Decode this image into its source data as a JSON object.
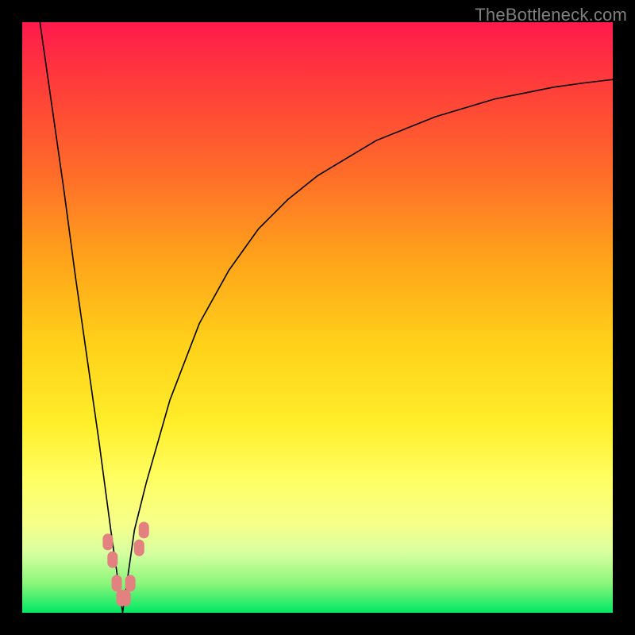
{
  "watermark": "TheBottleneck.com",
  "colors": {
    "frame": "#000000",
    "marker": "#e38080",
    "curve": "#000000",
    "gradient_top": "#ff1a4d",
    "gradient_bottom": "#00e865"
  },
  "chart_data": {
    "type": "line",
    "title": "",
    "xlabel": "",
    "ylabel": "",
    "xlim": [
      0,
      100
    ],
    "ylim": [
      0,
      100
    ],
    "description": "Absolute-difference / bottleneck curve: a sharp V reaching ~0 near x≈17, rising steeply on the left edge to ~100 and rising with diminishing slope toward ~90 at the right edge.",
    "series": [
      {
        "name": "bottleneck-curve",
        "x": [
          3,
          5,
          7,
          9,
          11,
          13,
          15,
          16,
          17,
          18,
          19,
          21,
          25,
          30,
          35,
          40,
          45,
          50,
          55,
          60,
          65,
          70,
          75,
          80,
          85,
          90,
          95,
          100
        ],
        "y": [
          100,
          86,
          72,
          57,
          43,
          29,
          14,
          7,
          0,
          7,
          14,
          22,
          36,
          49,
          58,
          65,
          70,
          74,
          77,
          80,
          82,
          84,
          85.5,
          87,
          88,
          89,
          89.7,
          90.3
        ]
      }
    ],
    "markers": {
      "name": "highlighted-points",
      "x": [
        14.5,
        15.3,
        16.0,
        16.8,
        17.5,
        18.3,
        19.8,
        20.6
      ],
      "y": [
        12,
        9,
        5,
        2.5,
        2.5,
        5,
        11,
        14
      ]
    }
  }
}
